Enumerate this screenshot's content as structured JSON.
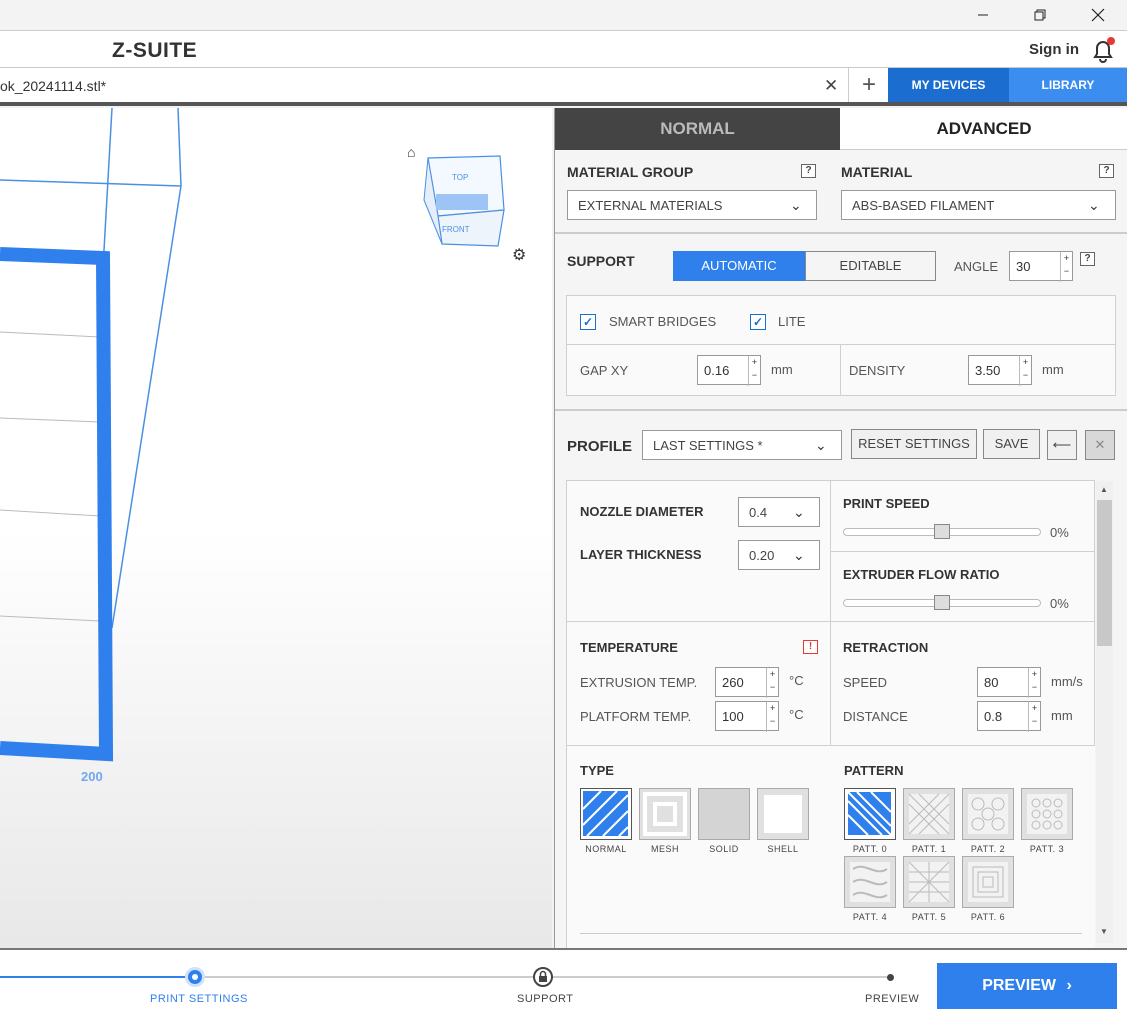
{
  "window": {
    "minimize_icon": "minimize-icon",
    "restore_icon": "restore-icon",
    "close_icon": "close-icon"
  },
  "app": {
    "logo": "Z-SUITE",
    "sign_in": "Sign in"
  },
  "tabs": {
    "file_name": "ok_20241114.stl*",
    "my_devices": "MY DEVICES",
    "library": "LIBRARY"
  },
  "viewport": {
    "axis_label": "200",
    "cube_top": "TOP",
    "cube_front": "FRONT"
  },
  "panel": {
    "mode_normal": "NORMAL",
    "mode_advanced": "ADVANCED",
    "material_group_label": "MATERIAL GROUP",
    "material_group_value": "EXTERNAL MATERIALS",
    "material_label": "MATERIAL",
    "material_value": "ABS-BASED FILAMENT",
    "help": "?",
    "support_label": "SUPPORT",
    "automatic": "AUTOMATIC",
    "editable": "EDITABLE",
    "angle_label": "ANGLE",
    "angle_value": "30",
    "smart_bridges": "SMART BRIDGES",
    "lite": "LITE",
    "gap_xy_label": "GAP XY",
    "gap_xy_value": "0.16",
    "density_label": "DENSITY",
    "density_value": "3.50",
    "mm": "mm",
    "profile_label": "PROFILE",
    "profile_value": "LAST SETTINGS *",
    "reset_settings": "RESET SETTINGS",
    "save": "SAVE",
    "nozzle_label": "NOZZLE DIAMETER",
    "nozzle_value": "0.4",
    "layer_label": "LAYER THICKNESS",
    "layer_value": "0.20",
    "print_speed_label": "PRINT SPEED",
    "print_speed_value": "0%",
    "print_speed_level": 0,
    "flow_label": "EXTRUDER FLOW RATIO",
    "flow_value": "0%",
    "flow_level": 0,
    "temperature_label": "TEMPERATURE",
    "warning": "!",
    "extrusion_label": "EXTRUSION TEMP.",
    "extrusion_value": "260",
    "platform_label": "PLATFORM TEMP.",
    "platform_value": "100",
    "deg_c": "°C",
    "retraction_label": "RETRACTION",
    "speed_label": "SPEED",
    "speed_value": "80",
    "speed_unit": "mm/s",
    "distance_label": "DISTANCE",
    "distance_value": "0.8",
    "type_label": "TYPE",
    "types": [
      "NORMAL",
      "MESH",
      "SOLID",
      "SHELL"
    ],
    "pattern_label": "PATTERN",
    "patterns": [
      "PATT. 0",
      "PATT. 1",
      "PATT. 2",
      "PATT. 3",
      "PATT. 4",
      "PATT. 5",
      "PATT. 6"
    ]
  },
  "steps": {
    "print_settings": "PRINT SETTINGS",
    "support": "SUPPORT",
    "preview": "PREVIEW",
    "preview_button": "PREVIEW"
  },
  "colors": {
    "accent": "#2f80ed",
    "dark_blue": "#1c6dd0",
    "dark_tab": "#444444",
    "notify": "#e53935"
  }
}
